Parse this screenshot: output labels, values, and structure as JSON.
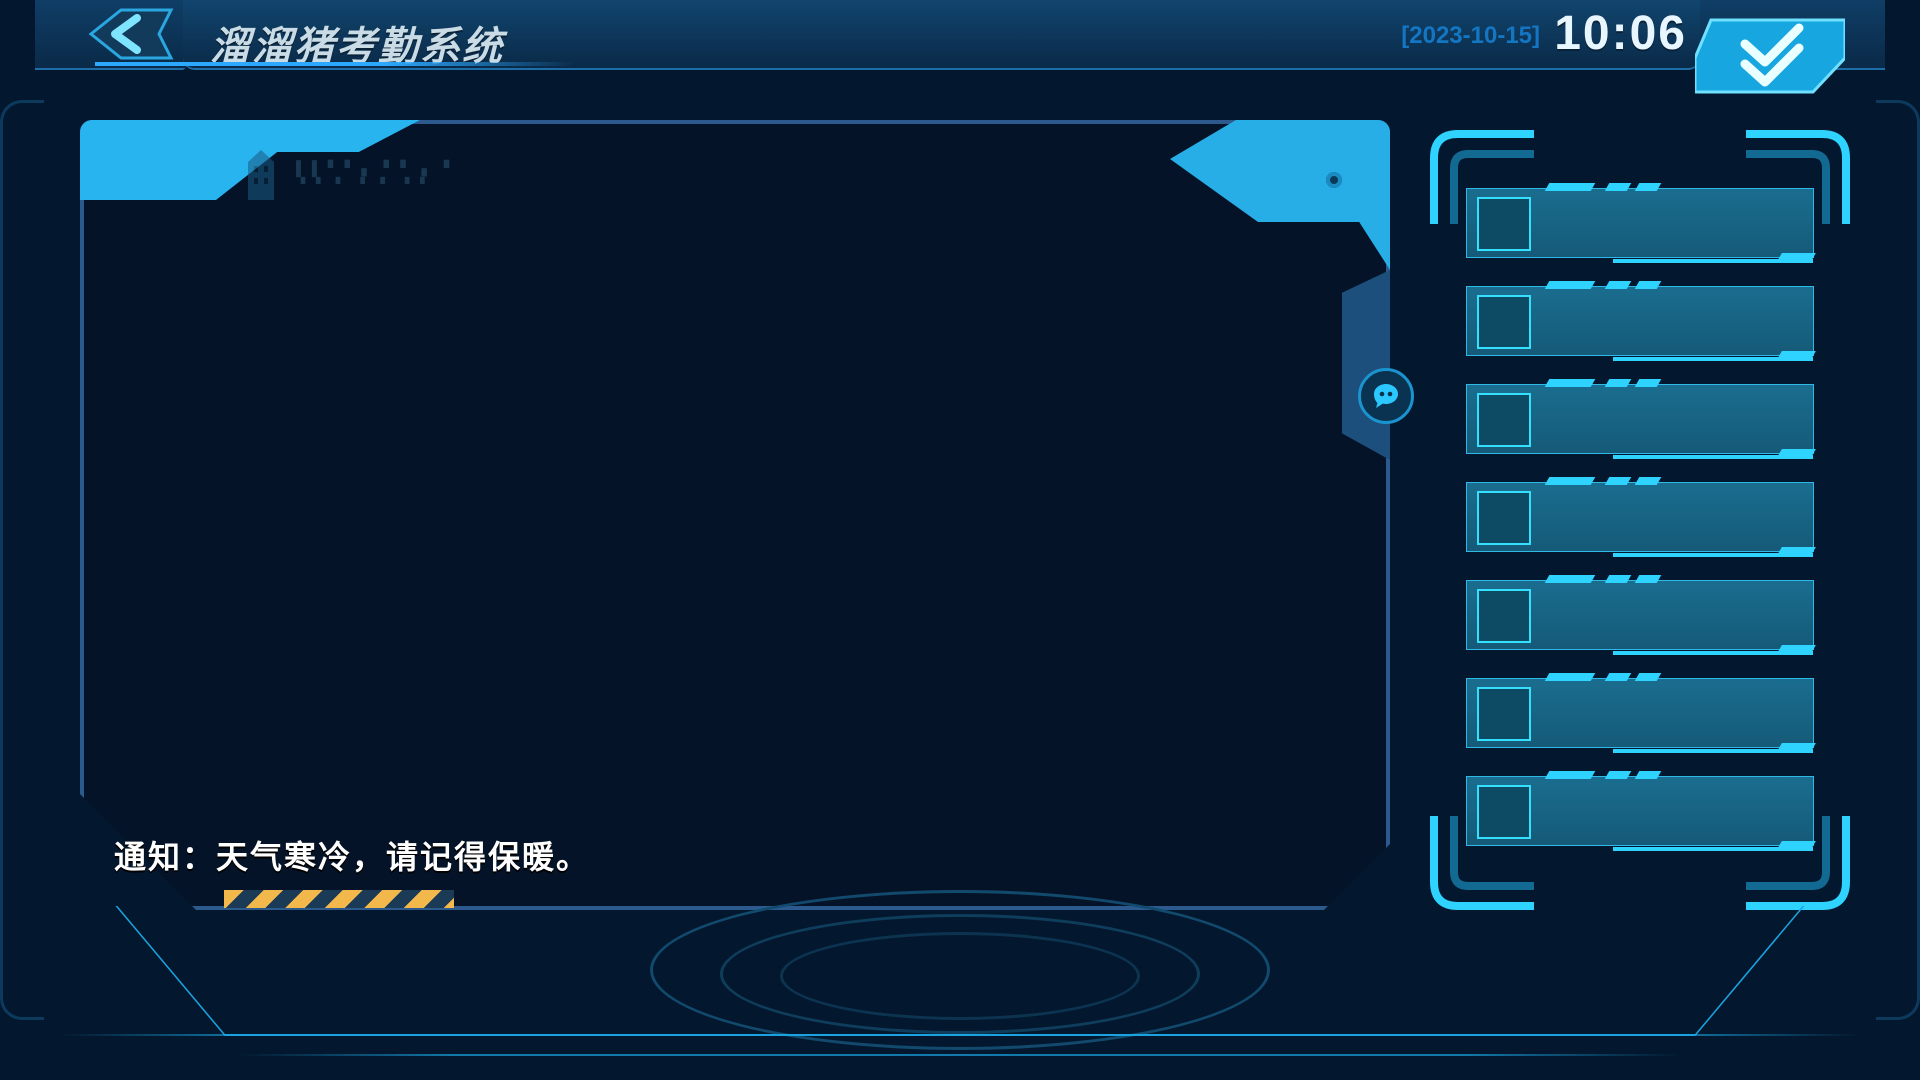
{
  "header": {
    "title": "溜溜猪考勤系统",
    "date": "[2023-10-15]",
    "time": "10:06"
  },
  "viewport": {
    "emblem_line1": "▌▌▘▘▖▝▝ ▖▝",
    "emblem_line2": "▝▝ ▘ ▘▝ ▝▝",
    "notice": "通知：天气寒冷，请记得保暖。"
  },
  "side_list": {
    "items": [
      {
        "label": ""
      },
      {
        "label": ""
      },
      {
        "label": ""
      },
      {
        "label": ""
      },
      {
        "label": ""
      },
      {
        "label": ""
      },
      {
        "label": ""
      }
    ]
  },
  "colors": {
    "accent": "#28b4ee",
    "frame": "#2c5a8e",
    "bg": "#03182e"
  }
}
